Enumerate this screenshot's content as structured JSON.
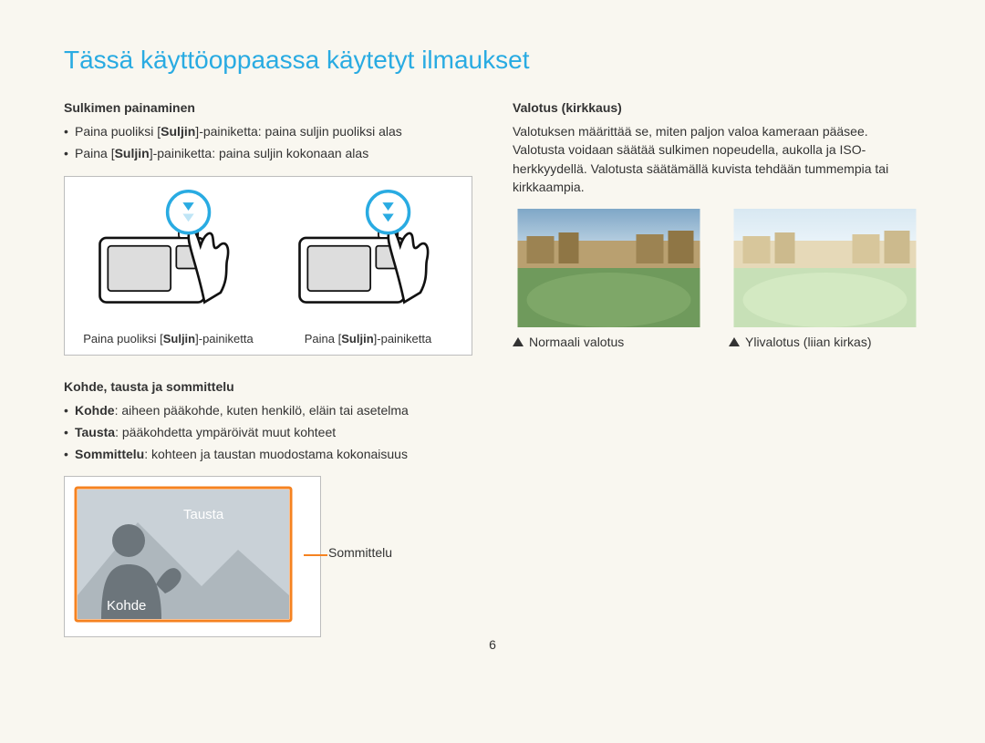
{
  "title": "Tässä käyttöoppaassa käytetyt ilmaukset",
  "left": {
    "shutter": {
      "title": "Sulkimen painaminen",
      "bullets": [
        {
          "pre": "Paina puoliksi ",
          "bold": "Suljin",
          "post": "-painiketta: paina suljin puoliksi alas"
        },
        {
          "pre": "Paina ",
          "bold": "Suljin",
          "post": "-painiketta: paina suljin kokonaan alas"
        }
      ],
      "captions": {
        "half_pre": "Paina puoliksi ",
        "half_bold": "Suljin",
        "half_post": "-painiketta",
        "full_pre": "Paina ",
        "full_bold": "Suljin",
        "full_post": "-painiketta"
      }
    },
    "composition": {
      "title": "Kohde, tausta ja sommittelu",
      "bullets": [
        {
          "bold": "Kohde",
          "post": ": aiheen pääkohde, kuten henkilö, eläin tai asetelma"
        },
        {
          "bold": "Tausta",
          "post": ": pääkohdetta ympäröivät muut kohteet"
        },
        {
          "bold": "Sommittelu",
          "post": ": kohteen ja taustan muodostama kokonaisuus"
        }
      ],
      "labels": {
        "tausta": "Tausta",
        "kohde": "Kohde",
        "sommittelu": "Sommittelu"
      }
    }
  },
  "right": {
    "exposure": {
      "title": "Valotus (kirkkaus)",
      "para": "Valotuksen määrittää se, miten paljon valoa kameraan pääsee. Valotusta voidaan säätää sulkimen nopeudella, aukolla ja ISO-herkkyydellä. Valotusta säätämällä kuvista tehdään tummempia tai kirkkaampia.",
      "captions": {
        "normal": "Normaali valotus",
        "over": "Ylivalotus (liian kirkas)"
      }
    }
  },
  "page_number": "6"
}
